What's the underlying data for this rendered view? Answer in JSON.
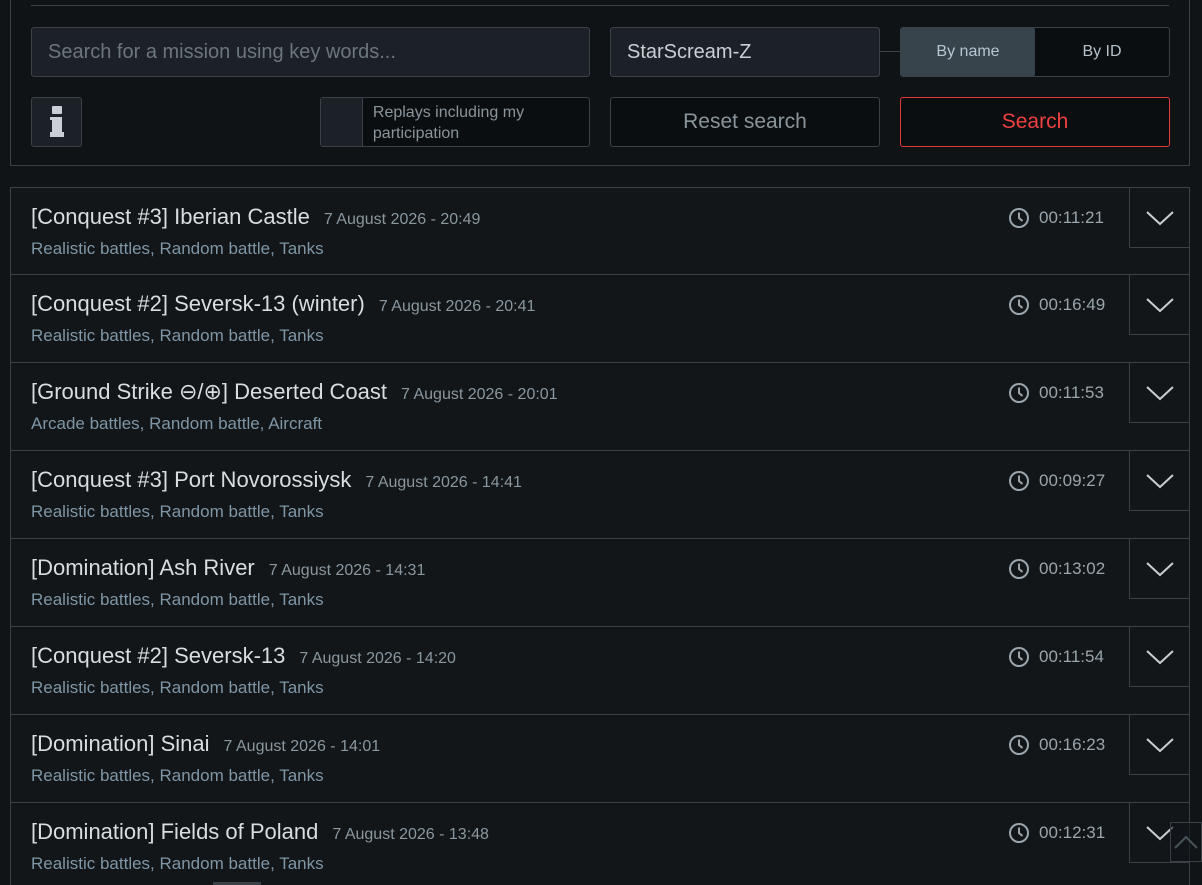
{
  "search": {
    "keyword_placeholder": "Search for a mission using key words...",
    "keyword_value": "",
    "player_name": "StarScream-Z",
    "mode_options": [
      "By name",
      "By ID"
    ],
    "mode_selected": "By name",
    "participation_label": "Replays including my participation",
    "reset_label": "Reset search",
    "search_label": "Search"
  },
  "colors": {
    "accent_red": "#ee4040",
    "active_toggle": "#38444c",
    "tag_text": "#7f96a6"
  },
  "replays": [
    {
      "title": "[Conquest #3] Iberian Castle",
      "date": "7 August 2026 - 20:49",
      "tags": "Realistic battles, Random battle, Tanks",
      "duration": "00:11:21"
    },
    {
      "title": "[Conquest #2] Seversk-13 (winter)",
      "date": "7 August 2026 - 20:41",
      "tags": "Realistic battles, Random battle, Tanks",
      "duration": "00:16:49"
    },
    {
      "title": "[Ground Strike ⊖/⊕] Deserted Coast",
      "date": "7 August 2026 - 20:01",
      "tags": "Arcade battles, Random battle, Aircraft",
      "duration": "00:11:53"
    },
    {
      "title": "[Conquest #3] Port Novorossiysk",
      "date": "7 August 2026 - 14:41",
      "tags": "Realistic battles, Random battle, Tanks",
      "duration": "00:09:27"
    },
    {
      "title": "[Domination] Ash River",
      "date": "7 August 2026 - 14:31",
      "tags": "Realistic battles, Random battle, Tanks",
      "duration": "00:13:02"
    },
    {
      "title": "[Conquest #2] Seversk-13",
      "date": "7 August 2026 - 14:20",
      "tags": "Realistic battles, Random battle, Tanks",
      "duration": "00:11:54"
    },
    {
      "title": "[Domination] Sinai",
      "date": "7 August 2026 - 14:01",
      "tags": "Realistic battles, Random battle, Tanks",
      "duration": "00:16:23"
    },
    {
      "title": "[Domination] Fields of Poland",
      "date": "7 August 2026 - 13:48",
      "tags": "Realistic battles, Random battle, Tanks",
      "duration": "00:12:31"
    }
  ],
  "icons": {
    "info": "info-icon",
    "clock": "clock-icon",
    "expand": "chevron-down-icon",
    "scroll_top": "chevron-up-icon"
  }
}
